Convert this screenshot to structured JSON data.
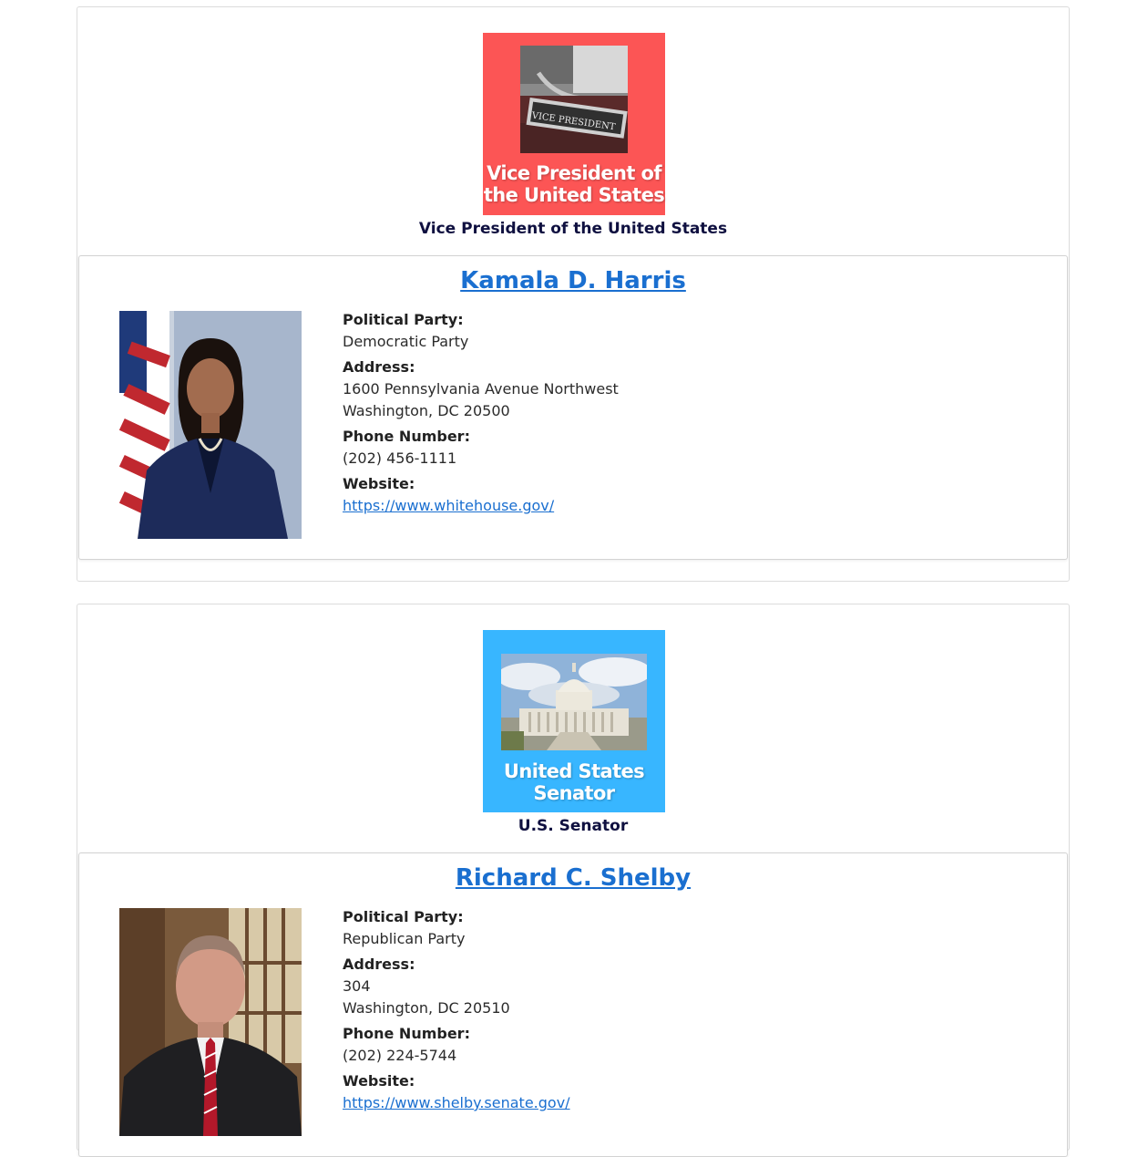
{
  "offices": [
    {
      "badge_caption": [
        "Vice President of",
        "the United States"
      ],
      "badge_sign_text": "VICE PRESIDENT",
      "badge_color": "#fc5555",
      "title": "Vice President of the United States",
      "official": {
        "name": "Kamala D. Harris",
        "party_label": "Political Party:",
        "party": "Democratic Party",
        "address_label": "Address:",
        "address_line1": "1600 Pennsylvania Avenue Northwest",
        "address_line2": "Washington, DC 20500",
        "phone_label": "Phone Number:",
        "phone": "(202) 456-1111",
        "website_label": "Website:",
        "website": "https://www.whitehouse.gov/"
      }
    },
    {
      "badge_caption": [
        "United States",
        "Senator"
      ],
      "badge_color": "#38b6ff",
      "title": "U.S. Senator",
      "official": {
        "name": "Richard C. Shelby",
        "party_label": "Political Party:",
        "party": "Republican Party",
        "address_label": "Address:",
        "address_line1": "304",
        "address_line2": "Washington, DC 20510",
        "phone_label": "Phone Number:",
        "phone": "(202) 224-5744",
        "website_label": "Website:",
        "website": "https://www.shelby.senate.gov/"
      }
    }
  ]
}
